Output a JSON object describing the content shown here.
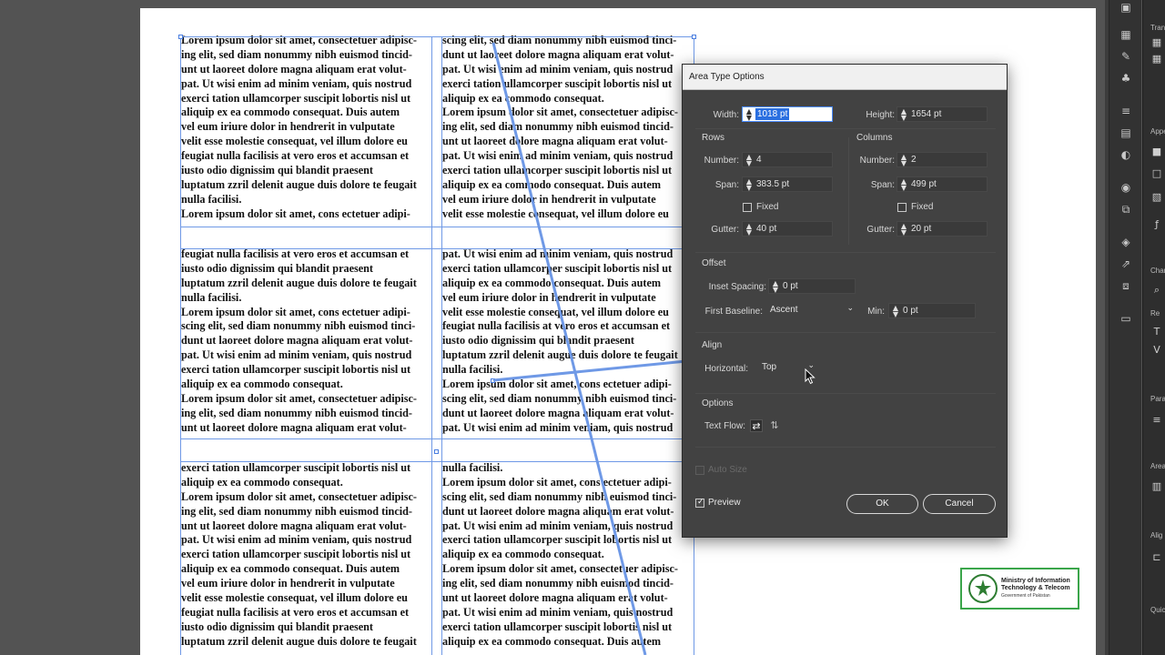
{
  "artboard": {
    "col_a_rows": [
      [
        "Lorem ipsum dolor sit amet, consectetuer adipisc-",
        "ing elit, sed diam nonummy nibh euismod tincid-",
        "unt ut laoreet dolore magna aliquam erat volut-",
        "pat. Ut wisi enim ad minim veniam, quis nostrud",
        "exerci tation ullamcorper suscipit lobortis nisl ut",
        "aliquip ex ea commodo consequat. Duis autem",
        "vel eum iriure dolor in hendrerit in vulputate",
        "velit esse molestie consequat, vel illum dolore eu",
        "feugiat nulla facilisis at vero eros et accumsan et",
        "iusto odio dignissim qui blandit praesent",
        "luptatum zzril delenit augue duis dolore te feugait",
        "nulla facilisi.",
        "Lorem ipsum dolor sit amet, cons ectetuer adipi-"
      ],
      [
        "feugiat nulla facilisis at vero eros et accumsan et",
        "iusto odio dignissim qui blandit praesent",
        "luptatum zzril delenit augue duis dolore te feugait",
        "nulla facilisi.",
        "Lorem ipsum dolor sit amet, cons ectetuer adipi-",
        "scing elit, sed diam nonummy nibh euismod tinci-",
        "dunt ut laoreet dolore magna aliquam erat volut-",
        "pat. Ut wisi enim ad minim veniam, quis nostrud",
        "exerci tation ullamcorper suscipit lobortis nisl ut",
        "aliquip ex ea commodo consequat.",
        "Lorem ipsum dolor sit amet, consectetuer adipisc-",
        "ing elit, sed diam nonummy nibh euismod tincid-",
        "unt ut laoreet dolore magna aliquam erat volut-"
      ],
      [
        "exerci tation ullamcorper suscipit lobortis nisl ut",
        "aliquip ex ea commodo consequat.",
        "Lorem ipsum dolor sit amet, consectetuer adipisc-",
        "ing elit, sed diam nonummy nibh euismod tincid-",
        "unt ut laoreet dolore magna aliquam erat volut-",
        "pat. Ut wisi enim ad minim veniam, quis nostrud",
        "exerci tation ullamcorper suscipit lobortis nisl ut",
        "aliquip ex ea commodo consequat. Duis autem",
        "vel eum iriure dolor in hendrerit in vulputate",
        "velit esse molestie consequat, vel illum dolore eu",
        "feugiat nulla facilisis at vero eros et accumsan et",
        "iusto odio dignissim qui blandit praesent",
        "luptatum zzril delenit augue duis dolore te feugait"
      ]
    ],
    "col_b_rows": [
      [
        "scing elit, sed diam nonummy nibh euismod tinci-",
        "dunt ut laoreet dolore magna aliquam erat volut-",
        "pat. Ut wisi enim ad minim veniam, quis nostrud",
        "exerci tation ullamcorper suscipit lobortis nisl ut",
        "aliquip ex ea commodo consequat.",
        "Lorem ipsum dolor sit amet, consectetuer adipisc-",
        "ing elit, sed diam nonummy nibh euismod tincid-",
        "unt ut laoreet dolore magna aliquam erat volut-",
        "pat. Ut wisi enim ad minim veniam, quis nostrud",
        "exerci tation ullamcorper suscipit lobortis nisl ut",
        "aliquip ex ea commodo consequat. Duis autem",
        "vel eum iriure dolor in hendrerit in vulputate",
        "velit esse molestie consequat, vel illum dolore eu"
      ],
      [
        "pat. Ut wisi enim ad minim veniam, quis nostrud",
        "exerci tation ullamcorper suscipit lobortis nisl ut",
        "aliquip ex ea commodo consequat. Duis autem",
        "vel eum iriure dolor in hendrerit in vulputate",
        "velit esse molestie consequat, vel illum dolore eu",
        "feugiat nulla facilisis at vero eros et accumsan et",
        "iusto odio dignissim qui blandit praesent",
        "luptatum zzril delenit augue duis dolore te feugait",
        "nulla facilisi.",
        "Lorem ipsum dolor sit amet, cons ectetuer adipi-",
        "scing elit, sed diam nonummy nibh euismod tinci-",
        "dunt ut laoreet dolore magna aliquam erat volut-",
        "pat. Ut wisi enim ad minim veniam, quis nostrud"
      ],
      [
        "nulla facilisi.",
        "Lorem ipsum dolor sit amet, cons ectetuer adipi-",
        "scing elit, sed diam nonummy nibh euismod tinci-",
        "dunt ut laoreet dolore magna aliquam erat volut-",
        "pat. Ut wisi enim ad minim veniam, quis nostrud",
        "exerci tation ullamcorper suscipit lobortis nisl ut",
        "aliquip ex ea commodo consequat.",
        "Lorem ipsum dolor sit amet, consectetuer adipisc-",
        "ing elit, sed diam nonummy nibh euismod tincid-",
        "unt ut laoreet dolore magna aliquam erat volut-",
        "pat. Ut wisi enim ad minim veniam, quis nostrud",
        "exerci tation ullamcorper suscipit lobortis nisl ut",
        "aliquip ex ea commodo consequat. Duis autem"
      ]
    ]
  },
  "dialog": {
    "title": "Area Type Options",
    "width_label": "Width:",
    "width_value": "1018 pt",
    "height_label": "Height:",
    "height_value": "1654 pt",
    "rows": {
      "heading": "Rows",
      "number_label": "Number:",
      "number_value": "4",
      "span_label": "Span:",
      "span_value": "383.5 pt",
      "fixed_label": "Fixed",
      "gutter_label": "Gutter:",
      "gutter_value": "40 pt"
    },
    "columns": {
      "heading": "Columns",
      "number_label": "Number:",
      "number_value": "2",
      "span_label": "Span:",
      "span_value": "499 pt",
      "fixed_label": "Fixed",
      "gutter_label": "Gutter:",
      "gutter_value": "20 pt"
    },
    "offset": {
      "heading": "Offset",
      "inset_label": "Inset Spacing:",
      "inset_value": "0 pt",
      "baseline_label": "First Baseline:",
      "baseline_value": "Ascent",
      "min_label": "Min:",
      "min_value": "0 pt"
    },
    "align": {
      "heading": "Align",
      "horizontal_label": "Horizontal:",
      "horizontal_value": "Top"
    },
    "options": {
      "heading": "Options",
      "text_flow_label": "Text Flow:"
    },
    "auto_size_label": "Auto Size",
    "preview_label": "Preview",
    "ok_label": "OK",
    "cancel_label": "Cancel"
  },
  "logo": {
    "line1": "Ministry of Information",
    "line2": "Technology & Telecom",
    "line3": "Government of Pakistan"
  },
  "panels": {
    "labels": [
      "Tran",
      "Appe",
      "Char",
      "Re",
      "Para",
      "Area",
      "Alig",
      "Quic"
    ]
  },
  "icons": {
    "spinner": "stepper-arrows-icon",
    "dropdown": "chevron-down-icon",
    "flow_rows": "text-flow-by-rows-icon",
    "flow_cols": "text-flow-by-columns-icon"
  },
  "colors": {
    "dialog_bg": "#424242",
    "selection_blue": "#6f99e6",
    "highlight_blue": "#2a6fe0",
    "logo_green": "#3aa54a"
  }
}
